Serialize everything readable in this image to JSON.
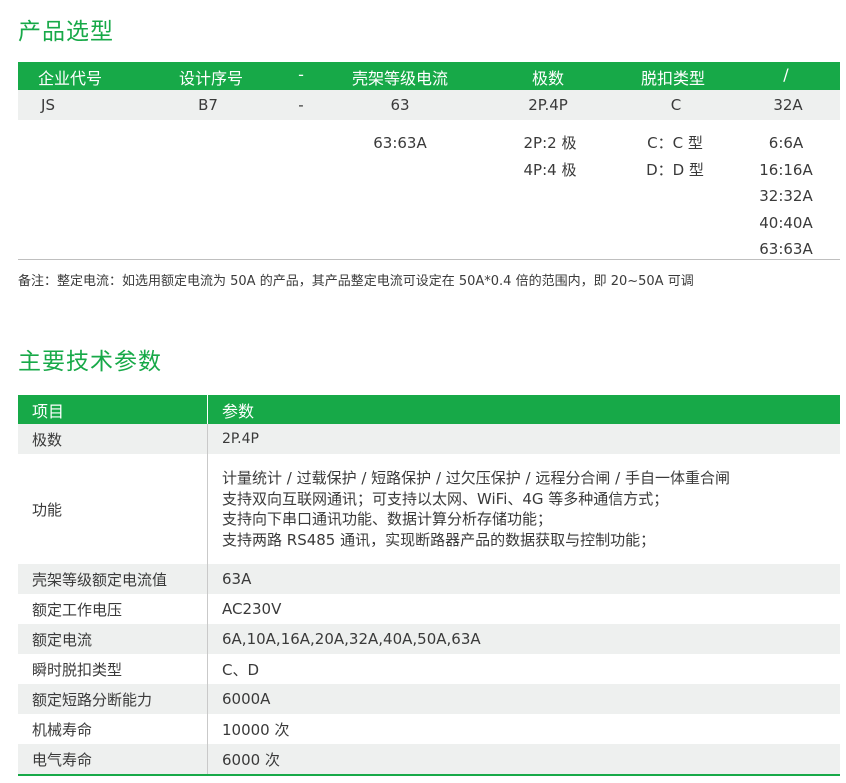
{
  "selection": {
    "title": "产品选型",
    "headers": [
      "企业代号",
      "设计序号",
      "-",
      "壳架等级电流",
      "极数",
      "脱扣类型",
      "/"
    ],
    "example": [
      "JS",
      "B7",
      "-",
      "63",
      "2P.4P",
      "C",
      "32A"
    ],
    "options": {
      "frame_current": [
        "63:63A"
      ],
      "poles": [
        "2P:2 极",
        "4P:4 极"
      ],
      "trip_type": [
        "C：C 型",
        "D：D 型"
      ],
      "rated_current": [
        "6:6A",
        "16:16A",
        "32:32A",
        "40:40A",
        "63:63A"
      ]
    },
    "note": "备注：整定电流：如选用额定电流为 50A 的产品，其产品整定电流可设定在 50A*0.4 倍的范围内，即 20~50A 可调"
  },
  "specs": {
    "title": "主要技术参数",
    "header": {
      "item": "项目",
      "param": "参数"
    },
    "rows": [
      {
        "item": "极数",
        "value": "2P.4P"
      },
      {
        "item": "功能",
        "lines": [
          "计量统计 / 过载保护 / 短路保护 / 过欠压保护 / 远程分合闸 / 手自一体重合闸",
          "支持双向互联网通讯；可支持以太网、WiFi、4G 等多种通信方式；",
          "支持向下串口通讯功能、数据计算分析存储功能；",
          "支持两路 RS485 通讯，实现断路器产品的数据获取与控制功能；"
        ]
      },
      {
        "item": "壳架等级额定电流值",
        "value": "63A"
      },
      {
        "item": "额定工作电压",
        "value": "AC230V"
      },
      {
        "item": "额定电流",
        "value": "6A,10A,16A,20A,32A,40A,50A,63A"
      },
      {
        "item": "瞬时脱扣类型",
        "value": "C、D"
      },
      {
        "item": "额定短路分断能力",
        "value": "6000A"
      },
      {
        "item": "机械寿命",
        "value": "10000 次"
      },
      {
        "item": "电气寿命",
        "value": "6000 次"
      }
    ]
  },
  "colors": {
    "accent": "#17a948",
    "row_alt": "#eef0ef"
  }
}
